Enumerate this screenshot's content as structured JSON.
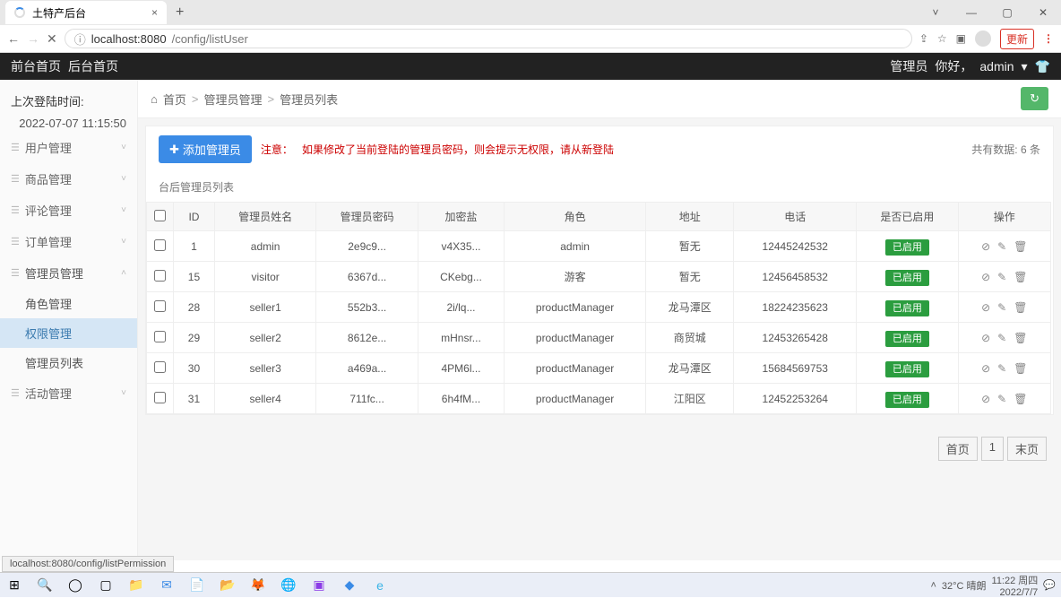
{
  "browser": {
    "tab_title": "土特产后台",
    "url_host": "localhost:8080",
    "url_path": "/config/listUser",
    "update_btn": "更新"
  },
  "topnav": {
    "front": "前台首页",
    "back": "后台首页",
    "role": "管理员",
    "greeting": "你好，",
    "username": "admin"
  },
  "sidebar": {
    "login_time_label": "上次登陆时间:",
    "login_time": "2022-07-07 11:15:50",
    "items": [
      {
        "label": "用户管理",
        "icon": "👤"
      },
      {
        "label": "商品管理",
        "icon": "👜"
      },
      {
        "label": "评论管理",
        "icon": "💬"
      },
      {
        "label": "订单管理",
        "icon": "📋"
      },
      {
        "label": "管理员管理",
        "icon": "👤"
      },
      {
        "label": "活动管理",
        "icon": "⚙"
      }
    ],
    "submenu": [
      {
        "label": "角色管理"
      },
      {
        "label": "权限管理"
      },
      {
        "label": "管理员列表"
      }
    ]
  },
  "breadcrumb": {
    "home": "首页",
    "l1": "管理员管理",
    "l2": "管理员列表"
  },
  "page": {
    "add_btn": "添加管理员",
    "notice_label": "注意：",
    "notice_text": "如果修改了当前登陆的管理员密码，则会提示无权限，请从新登陆",
    "total_label": "共有数据:",
    "total_value": "6 条",
    "subheader": "台后管理员列表"
  },
  "table": {
    "headers": [
      "",
      "ID",
      "管理员姓名",
      "管理员密码",
      "加密盐",
      "角色",
      "地址",
      "电话",
      "是否已启用",
      "操作"
    ],
    "rows": [
      {
        "id": "1",
        "name": "admin",
        "pwd": "2e9c9...",
        "salt": "v4X35...",
        "role": "admin",
        "addr": "暂无",
        "phone": "12445242532",
        "status": "已启用"
      },
      {
        "id": "15",
        "name": "visitor",
        "pwd": "6367d...",
        "salt": "CKebg...",
        "role": "游客",
        "addr": "暂无",
        "phone": "12456458532",
        "status": "已启用"
      },
      {
        "id": "28",
        "name": "seller1",
        "pwd": "552b3...",
        "salt": "2i/lq...",
        "role": "productManager",
        "addr": "龙马潭区",
        "phone": "18224235623",
        "status": "已启用"
      },
      {
        "id": "29",
        "name": "seller2",
        "pwd": "8612e...",
        "salt": "mHnsr...",
        "role": "productManager",
        "addr": "商贸城",
        "phone": "12453265428",
        "status": "已启用"
      },
      {
        "id": "30",
        "name": "seller3",
        "pwd": "a469a...",
        "salt": "4PM6l...",
        "role": "productManager",
        "addr": "龙马潭区",
        "phone": "15684569753",
        "status": "已启用"
      },
      {
        "id": "31",
        "name": "seller4",
        "pwd": "711fc...",
        "salt": "6h4fM...",
        "role": "productManager",
        "addr": "江阳区",
        "phone": "12452253264",
        "status": "已启用"
      }
    ]
  },
  "pager": {
    "first": "首页",
    "page": "1",
    "last": "末页"
  },
  "status_bar": "localhost:8080/config/listPermission",
  "taskbar": {
    "weather": "32°C 晴朗",
    "time": "11:22 周四",
    "date": "2022/7/7"
  }
}
